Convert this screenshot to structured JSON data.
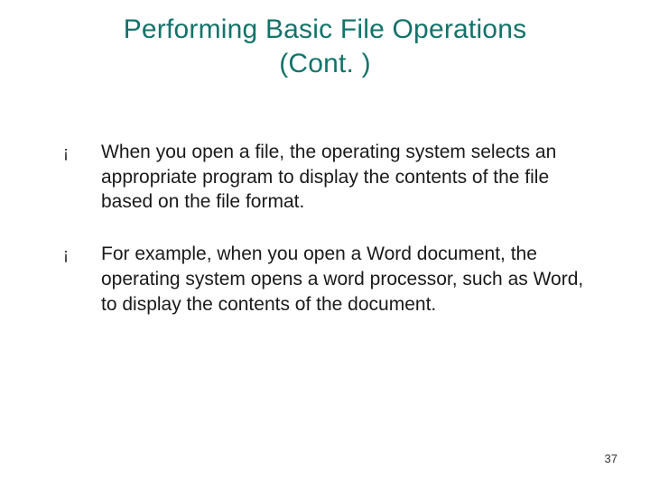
{
  "title_line1": "Performing Basic File Operations",
  "title_line2": "(Cont. )",
  "bullets": [
    "When you open a file, the operating system selects an appropriate program to display the contents of the file based on the file format.",
    "For example, when you open a Word document, the operating system opens a word processor, such as Word, to display the contents of the document."
  ],
  "bullet_glyph": "¡",
  "page_number": "37"
}
